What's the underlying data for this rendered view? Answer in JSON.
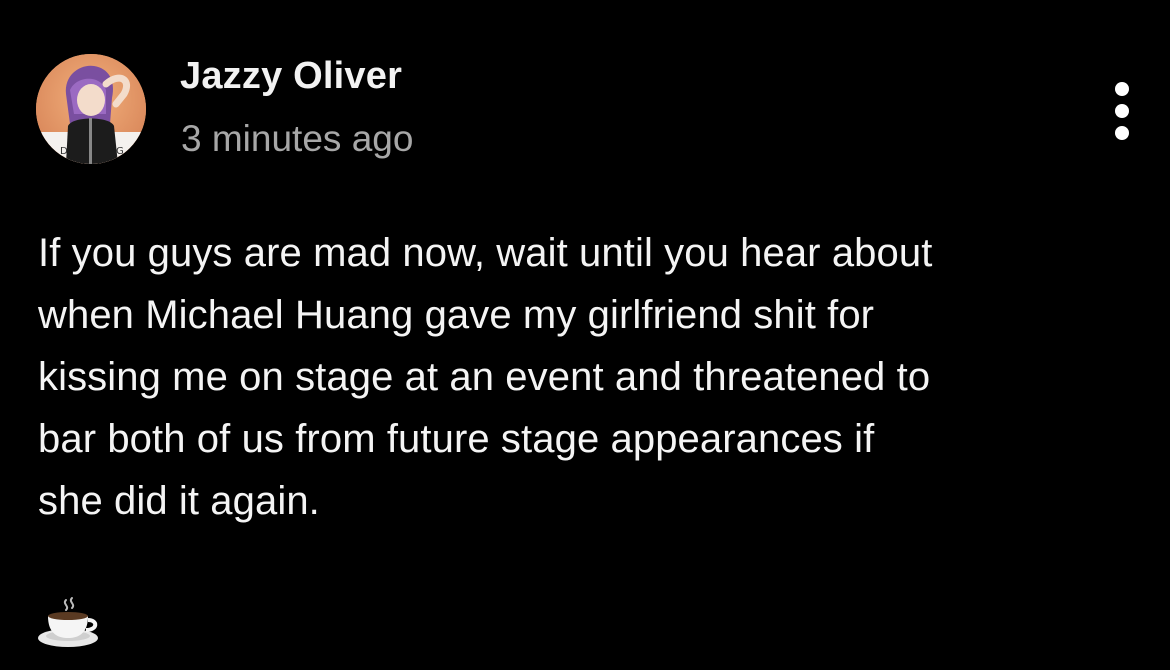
{
  "post": {
    "author": {
      "name": "Jazzy Oliver",
      "avatar_icon": "user-avatar"
    },
    "timestamp": "3 minutes ago",
    "menu_icon": "vertical-ellipsis-icon",
    "body_lines": [
      "If you guys are mad now, wait until you hear about",
      "when Michael Huang gave my girlfriend shit for",
      "kissing me on stage at an event and threatened to",
      "bar both of us from future stage appearances if",
      "she did it again."
    ],
    "reaction_icon": "coffee-cup-icon"
  },
  "colors": {
    "background": "#000000",
    "name_text": "#f2f2f2",
    "timestamp_text": "#a7a7a7",
    "body_text": "#f4f4f4"
  }
}
